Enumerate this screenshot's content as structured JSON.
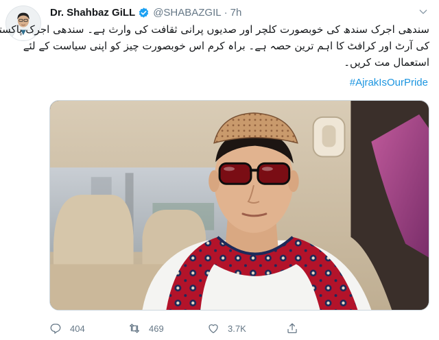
{
  "tweet": {
    "author": {
      "name": "Dr. Shahbaz GiLL",
      "handle": "@SHABAZGIL",
      "time": "7h",
      "separator": "·"
    },
    "text_lines": [
      "سندھی اجرک سندھ کی خوبصورت کلچر اور صدیوں پرانی ثقافت کی وارث ہے۔ سندھی اجرک پاکستان",
      "کی آرٹ اور کرافٹ کا اہم ترین حصہ ہے۔ براہ کرم اس خوبصورت چیز کو اپنی سیاست کے لئے",
      "استعمال مت کریں۔"
    ],
    "hashtag": "#AjrakIsOurPride",
    "stats": {
      "replies": "404",
      "retweets": "469",
      "likes": "3.7K"
    },
    "icons": {
      "verified": "verified-badge-icon",
      "more": "chevron-down-icon",
      "reply": "reply-icon",
      "retweet": "retweet-icon",
      "like": "heart-icon",
      "share": "share-icon"
    },
    "colors": {
      "accent": "#1b95e0",
      "muted": "#657786",
      "text": "#14171a"
    }
  }
}
